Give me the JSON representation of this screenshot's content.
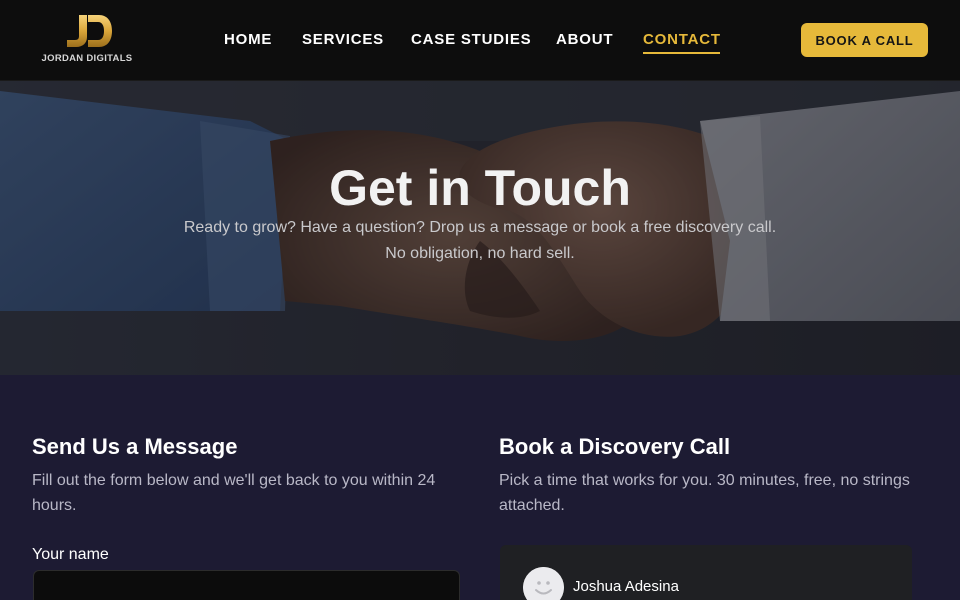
{
  "brand": {
    "logo_monogram": "JD",
    "logo_text": "JORDAN DIGITALS"
  },
  "nav": {
    "items": [
      {
        "label": "HOME",
        "active": false
      },
      {
        "label": "SERVICES",
        "active": false
      },
      {
        "label": "CASE STUDIES",
        "active": false
      },
      {
        "label": "ABOUT",
        "active": false
      },
      {
        "label": "CONTACT",
        "active": true
      }
    ],
    "cta_label": "BOOK A CALL"
  },
  "hero": {
    "title": "Get in Touch",
    "subtitle": "Ready to grow? Have a question? Drop us a message or book a free discovery call. No obligation, no hard sell.",
    "image_icon": "handshake-photo"
  },
  "message_form": {
    "title": "Send Us a Message",
    "description": "Fill out the form below and we'll get back to you within 24 hours.",
    "name_label": "Your name",
    "name_value": ""
  },
  "discovery_call": {
    "title": "Book a Discovery Call",
    "description": "Pick a time that works for you. 30 minutes, free, no strings attached.",
    "host_name": "Joshua Adesina",
    "host_avatar_icon": "user-avatar-icon"
  },
  "colors": {
    "accent": "#e6b93a",
    "header_bg": "#0d0d0d",
    "section_bg": "#1d1b33",
    "card_bg": "#1f2023"
  }
}
